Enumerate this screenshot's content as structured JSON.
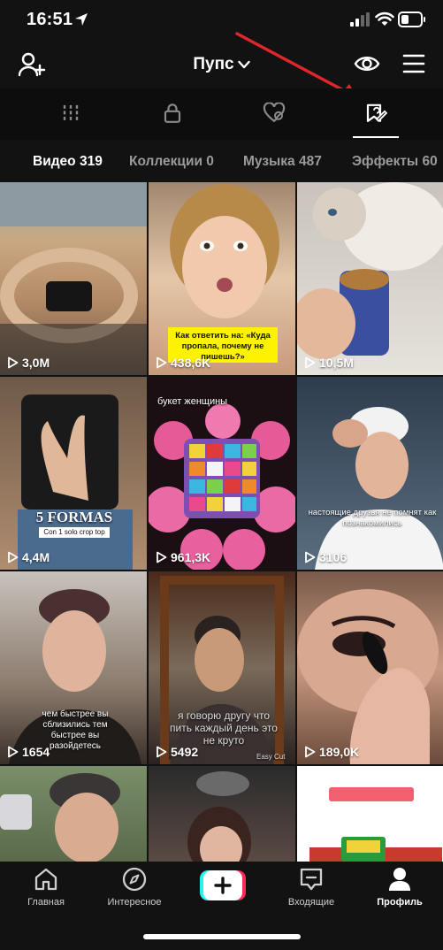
{
  "status_bar": {
    "time": "16:51"
  },
  "header": {
    "profile_name": "Пупс"
  },
  "content_tabs": [
    {
      "label": "Видео 319",
      "active": true
    },
    {
      "label": "Коллекции 0",
      "active": false
    },
    {
      "label": "Музыка 487",
      "active": false
    },
    {
      "label": "Эффекты 60",
      "active": false
    }
  ],
  "icon_tabs": [
    "grid-icon",
    "lock-icon",
    "liked-heart-icon",
    "favorites-icon"
  ],
  "videos": [
    {
      "views": "3,0M",
      "caption": ""
    },
    {
      "views": "438,6K",
      "caption": "Как ответить на: «Куда пропала, почему не пишешь?»"
    },
    {
      "views": "10,5M",
      "caption": ""
    },
    {
      "views": "4,4M",
      "caption": "5 FORMAS",
      "subcaption": "Con 1 solo crop top"
    },
    {
      "views": "961,3K",
      "caption": "букет женщины"
    },
    {
      "views": "3106",
      "caption": "настоящие друзья не помнят как познакомились"
    },
    {
      "views": "1654",
      "caption": "чем быстрее вы сблизились тем быстрее вы разойдетесь"
    },
    {
      "views": "5492",
      "caption": "я говорю другу что пить каждый день это не круто",
      "watermark": "Easy Cut"
    },
    {
      "views": "189,0K",
      "caption": ""
    },
    {
      "views": "",
      "caption": ""
    },
    {
      "views": "",
      "caption": ""
    },
    {
      "views": "",
      "caption": ""
    }
  ],
  "bottom_nav": [
    {
      "label": "Главная",
      "icon": "home-icon"
    },
    {
      "label": "Интересное",
      "icon": "compass-icon"
    },
    {
      "label": "",
      "icon": "plus-icon"
    },
    {
      "label": "Входящие",
      "icon": "inbox-icon"
    },
    {
      "label": "Профиль",
      "icon": "profile-icon"
    }
  ],
  "colors": {
    "background": "#121212",
    "accent_red": "#e0262b",
    "create_cyan": "#25f4ee",
    "create_pink": "#fe2c55"
  }
}
